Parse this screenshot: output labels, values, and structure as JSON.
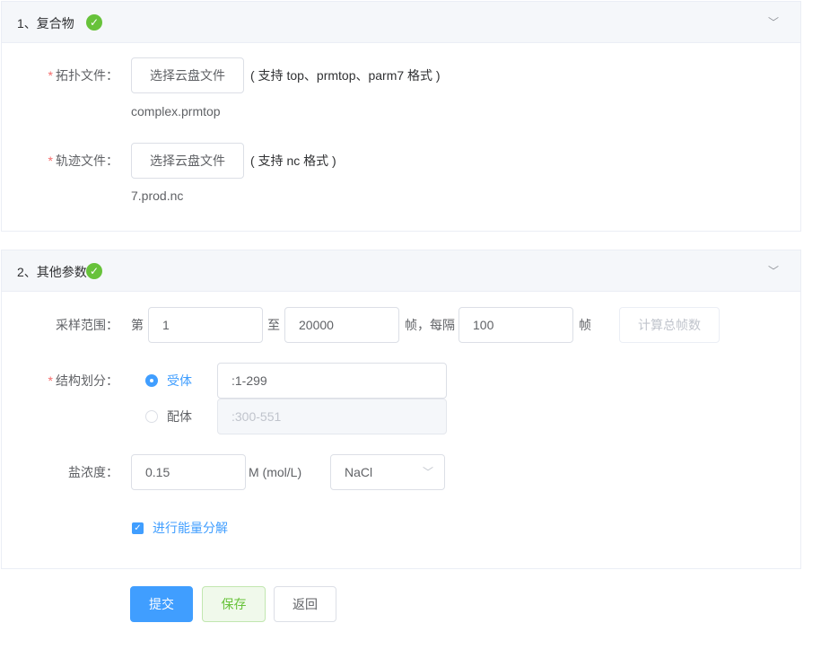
{
  "section1": {
    "title": "1、复合物",
    "topology": {
      "label": "拓扑文件：",
      "button": "选择云盘文件",
      "hint": "( 支持 top、prmtop、parm7 格式 )",
      "file": "complex.prmtop"
    },
    "trajectory": {
      "label": "轨迹文件：",
      "button": "选择云盘文件",
      "hint": "( 支持 nc 格式 )",
      "file": "7.prod.nc"
    }
  },
  "section2": {
    "title": "2、其他参数",
    "sampling": {
      "label": "采样范围：",
      "from_prefix": "第",
      "from": "1",
      "to_prefix": "至",
      "to": "20000",
      "step_prefix": "帧，每隔",
      "step": "100",
      "step_suffix": "帧",
      "calc_button": "计算总帧数"
    },
    "structure": {
      "label": "结构划分：",
      "receptor_label": "受体",
      "receptor_value": ":1-299",
      "ligand_label": "配体",
      "ligand_value": ":300-551",
      "selected": "受体"
    },
    "salt": {
      "label": "盐浓度：",
      "value": "0.15",
      "unit": "M (mol/L)",
      "type": "NaCl"
    },
    "decomposition": {
      "label": "进行能量分解",
      "checked": true
    }
  },
  "actions": {
    "submit": "提交",
    "save": "保存",
    "back": "返回"
  },
  "required_mark": "*"
}
